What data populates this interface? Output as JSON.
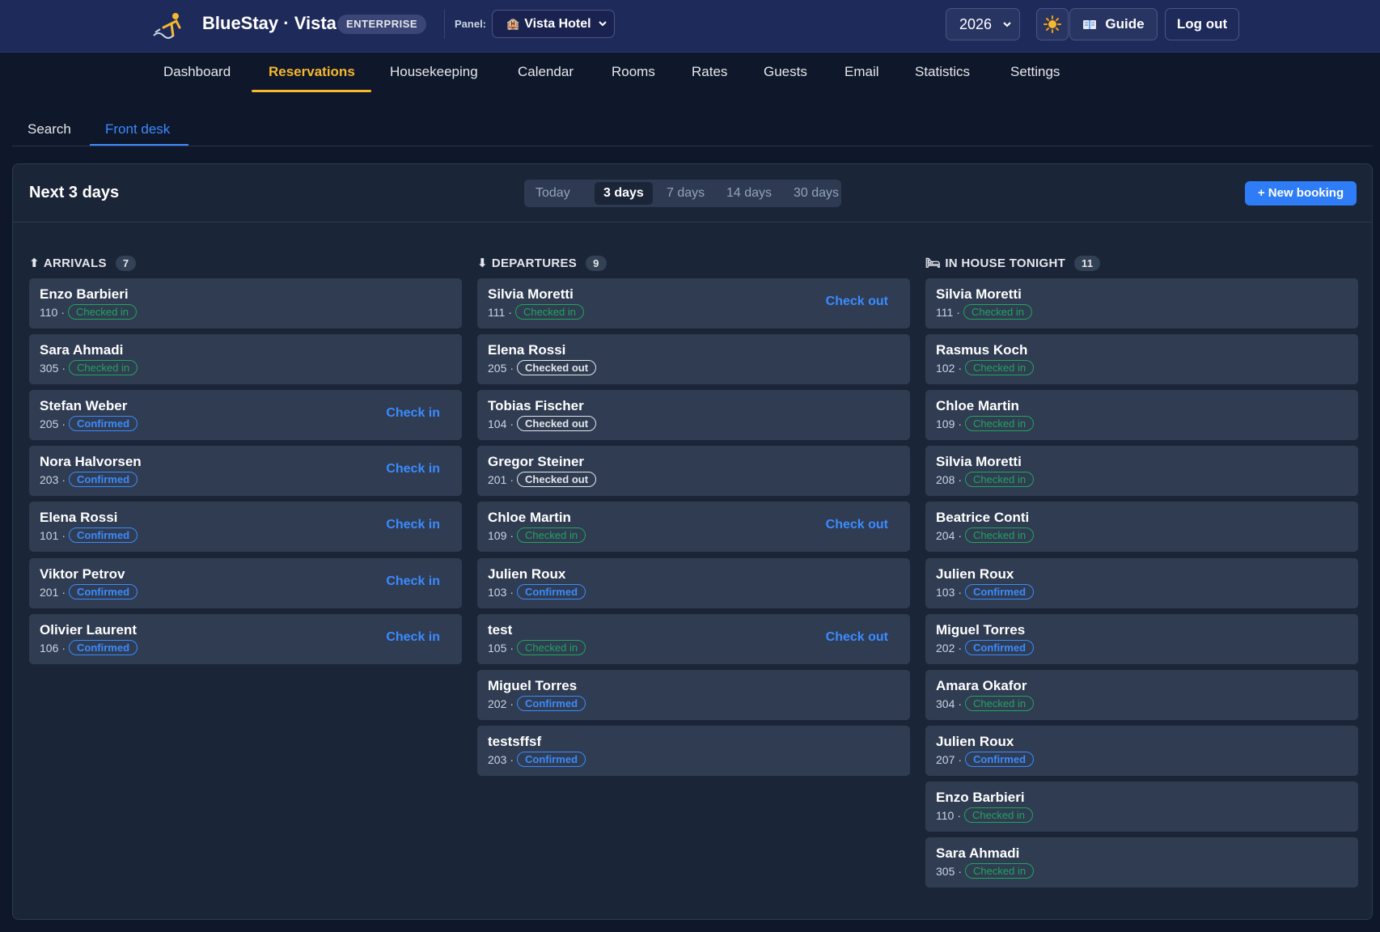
{
  "header": {
    "brand": "BlueStay · Vista",
    "edition": "ENTERPRISE",
    "panel_label": "Panel:",
    "hotel": "Vista Hotel",
    "year": "2026",
    "guide": "Guide",
    "logout": "Log out"
  },
  "nav": {
    "items": [
      "Dashboard",
      "Reservations",
      "Housekeeping",
      "Calendar",
      "Rooms",
      "Rates",
      "Guests",
      "Email",
      "Statistics",
      "Settings"
    ],
    "active": "Reservations"
  },
  "subtabs": {
    "items": [
      "Search",
      "Front desk"
    ],
    "active": "Front desk"
  },
  "panel": {
    "title": "Next 3 days",
    "ranges": [
      "Today",
      "3 days",
      "7 days",
      "14 days",
      "30 days"
    ],
    "active_range": "3 days",
    "new_booking": "+ New booking"
  },
  "columns": {
    "arrivals": {
      "icon": "⬆",
      "title": "ARRIVALS",
      "count": "7",
      "action_label": "Check in",
      "items": [
        {
          "name": "Enzo Barbieri",
          "room": "110",
          "status": "Checked in",
          "action": false
        },
        {
          "name": "Sara Ahmadi",
          "room": "305",
          "status": "Checked in",
          "action": false
        },
        {
          "name": "Stefan Weber",
          "room": "205",
          "status": "Confirmed",
          "action": true
        },
        {
          "name": "Nora Halvorsen",
          "room": "203",
          "status": "Confirmed",
          "action": true
        },
        {
          "name": "Elena Rossi",
          "room": "101",
          "status": "Confirmed",
          "action": true
        },
        {
          "name": "Viktor Petrov",
          "room": "201",
          "status": "Confirmed",
          "action": true
        },
        {
          "name": "Olivier Laurent",
          "room": "106",
          "status": "Confirmed",
          "action": true
        }
      ]
    },
    "departures": {
      "icon": "⬇",
      "title": "DEPARTURES",
      "count": "9",
      "action_label": "Check out",
      "items": [
        {
          "name": "Silvia Moretti",
          "room": "111",
          "status": "Checked in",
          "action": true
        },
        {
          "name": "Elena Rossi",
          "room": "205",
          "status": "Checked out",
          "action": false
        },
        {
          "name": "Tobias Fischer",
          "room": "104",
          "status": "Checked out",
          "action": false
        },
        {
          "name": "Gregor Steiner",
          "room": "201",
          "status": "Checked out",
          "action": false
        },
        {
          "name": "Chloe Martin",
          "room": "109",
          "status": "Checked in",
          "action": true
        },
        {
          "name": "Julien Roux",
          "room": "103",
          "status": "Confirmed",
          "action": false
        },
        {
          "name": "test",
          "room": "105",
          "status": "Checked in",
          "action": true
        },
        {
          "name": "Miguel Torres",
          "room": "202",
          "status": "Confirmed",
          "action": false
        },
        {
          "name": "testsffsf",
          "room": "203",
          "status": "Confirmed",
          "action": false
        }
      ]
    },
    "inhouse": {
      "icon": "🛏",
      "title": "IN HOUSE TONIGHT",
      "count": "11",
      "action_label": "",
      "items": [
        {
          "name": "Silvia Moretti",
          "room": "111",
          "status": "Checked in",
          "action": false
        },
        {
          "name": "Rasmus Koch",
          "room": "102",
          "status": "Checked in",
          "action": false
        },
        {
          "name": "Chloe Martin",
          "room": "109",
          "status": "Checked in",
          "action": false
        },
        {
          "name": "Silvia Moretti",
          "room": "208",
          "status": "Checked in",
          "action": false
        },
        {
          "name": "Beatrice Conti",
          "room": "204",
          "status": "Checked in",
          "action": false
        },
        {
          "name": "Julien Roux",
          "room": "103",
          "status": "Confirmed",
          "action": false
        },
        {
          "name": "Miguel Torres",
          "room": "202",
          "status": "Confirmed",
          "action": false
        },
        {
          "name": "Amara Okafor",
          "room": "304",
          "status": "Checked in",
          "action": false
        },
        {
          "name": "Julien Roux",
          "room": "207",
          "status": "Confirmed",
          "action": false
        },
        {
          "name": "Enzo Barbieri",
          "room": "110",
          "status": "Checked in",
          "action": false
        },
        {
          "name": "Sara Ahmadi",
          "room": "305",
          "status": "Checked in",
          "action": false
        }
      ]
    }
  },
  "colors": {
    "accent": "#3b8bff",
    "nav_active": "#f5b82e",
    "checked_in": "#22a55b",
    "header_bg": "#1e2a5a"
  }
}
